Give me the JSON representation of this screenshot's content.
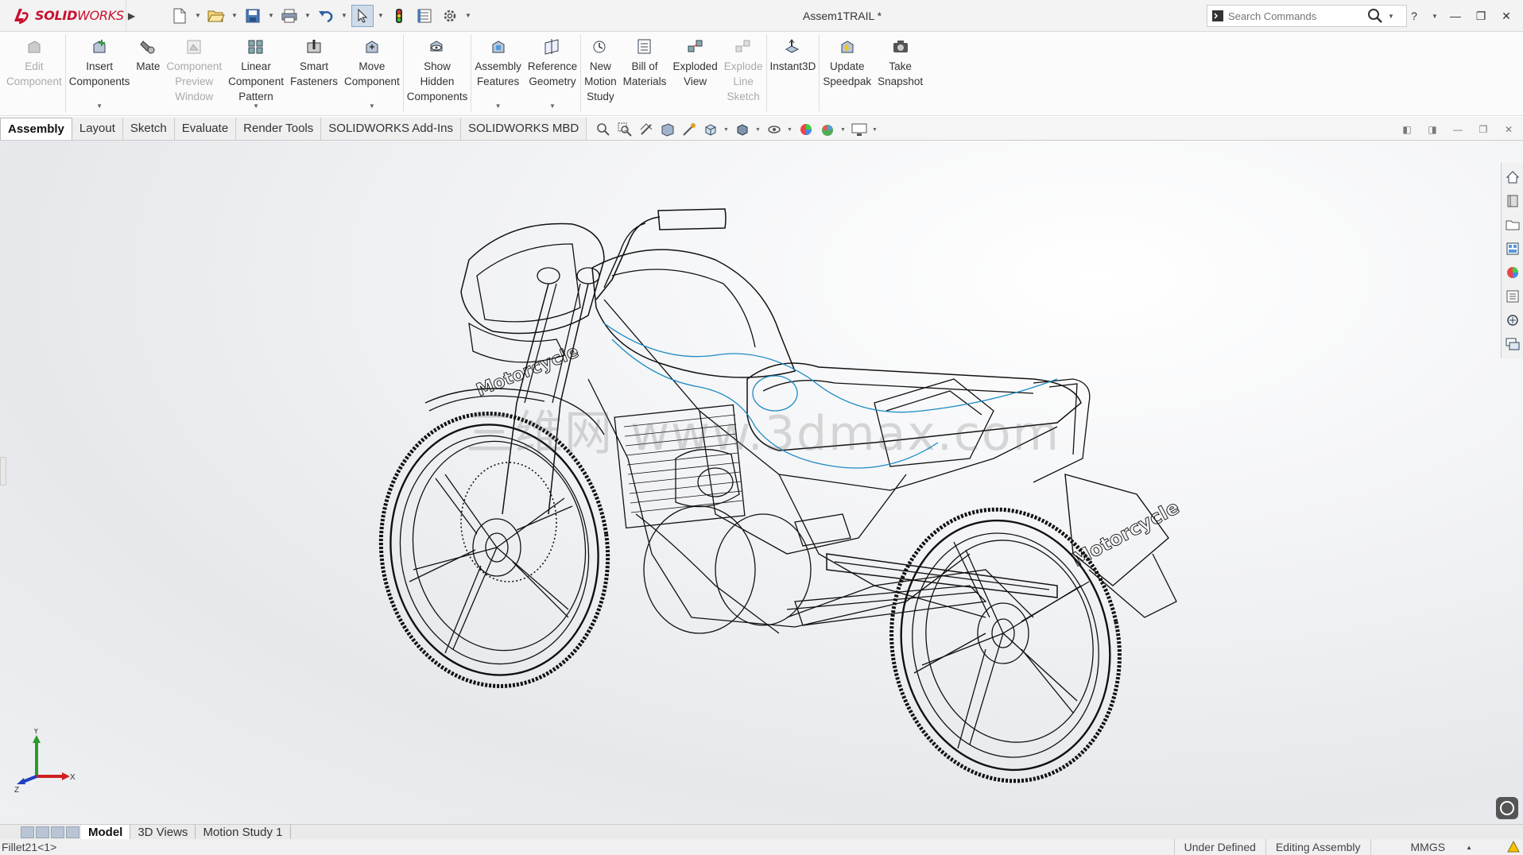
{
  "app": {
    "brand_bold": "SOLID",
    "brand_light": "WORKS",
    "doc_title": "Assem1TRAIL *"
  },
  "quick_access": [
    "new-icon",
    "open-icon",
    "save-icon",
    "print-icon",
    "undo-icon",
    "select-icon",
    "rebuild-icon",
    "file-properties-icon",
    "options-icon"
  ],
  "search": {
    "placeholder": "Search Commands"
  },
  "commands": [
    {
      "label": "Edit\nComponent",
      "icon": "edit-component-icon",
      "disabled": true
    },
    {
      "label": "Insert\nComponents",
      "icon": "insert-components-icon",
      "disabled": false
    },
    {
      "label": "Mate",
      "icon": "mate-icon",
      "disabled": false
    },
    {
      "label": "Component\nPreview\nWindow",
      "icon": "component-preview-icon",
      "disabled": true
    },
    {
      "label": "Linear\nComponent\nPattern",
      "icon": "linear-pattern-icon",
      "disabled": false
    },
    {
      "label": "Smart\nFasteners",
      "icon": "smart-fasteners-icon",
      "disabled": false
    },
    {
      "label": "Move\nComponent",
      "icon": "move-component-icon",
      "disabled": false
    },
    {
      "label": "Show\nHidden\nComponents",
      "icon": "show-hidden-icon",
      "disabled": false
    },
    {
      "label": "Assembly\nFeatures",
      "icon": "assembly-features-icon",
      "disabled": false
    },
    {
      "label": "Reference\nGeometry",
      "icon": "reference-geometry-icon",
      "disabled": false
    },
    {
      "label": "New\nMotion\nStudy",
      "icon": "motion-study-icon",
      "disabled": false
    },
    {
      "label": "Bill of\nMaterials",
      "icon": "bom-icon",
      "disabled": false
    },
    {
      "label": "Exploded\nView",
      "icon": "exploded-view-icon",
      "disabled": false
    },
    {
      "label": "Explode\nLine\nSketch",
      "icon": "explode-line-icon",
      "disabled": true
    },
    {
      "label": "Instant3D",
      "icon": "instant3d-icon",
      "disabled": false
    },
    {
      "label": "Update\nSpeedpak",
      "icon": "speedpak-icon",
      "disabled": false
    },
    {
      "label": "Take\nSnapshot",
      "icon": "snapshot-icon",
      "disabled": false
    }
  ],
  "tabs": [
    "Assembly",
    "Layout",
    "Sketch",
    "Evaluate",
    "Render Tools",
    "SOLIDWORKS Add-Ins",
    "SOLIDWORKS MBD"
  ],
  "active_tab": "Assembly",
  "watermark": "三维网 www.3dmax.com",
  "triad": {
    "x": "X",
    "y": "Y",
    "z": "Z"
  },
  "decals": {
    "front": "Motorcycle",
    "rear": "Motorcycle"
  },
  "bottom_tabs": [
    "Model",
    "3D Views",
    "Motion Study 1"
  ],
  "status": {
    "selection": "Fillet21<1>",
    "state": "Under Defined",
    "mode": "Editing Assembly",
    "units": "MMGS"
  },
  "colors": {
    "brand": "#c8102e",
    "highlight_blue": "#1e8bc3"
  }
}
